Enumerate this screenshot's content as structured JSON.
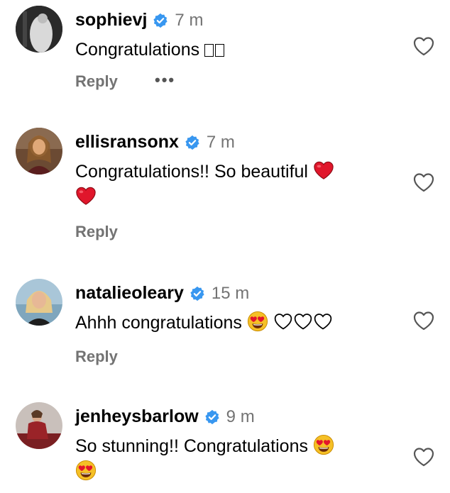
{
  "comments": [
    {
      "username": "sophievj",
      "time": "7 m",
      "text": "Congratulations",
      "text_suffix_glyphs": "□□",
      "reply_label": "Reply",
      "more_label": "•••",
      "verified": true
    },
    {
      "username": "ellisransonx",
      "time": "7 m",
      "text": "Congratulations!! So beautiful",
      "emojis": [
        "red-heart",
        "red-heart"
      ],
      "reply_label": "Reply",
      "verified": true
    },
    {
      "username": "natalieoleary",
      "time": "15 m",
      "text": "Ahhh congratulations",
      "emojis": [
        "heart-eyes",
        "white-heart",
        "white-heart",
        "white-heart"
      ],
      "reply_label": "Reply",
      "verified": true
    },
    {
      "username": "jenheysbarlow",
      "time": "9 m",
      "text": "So stunning!! Congratulations",
      "emojis": [
        "heart-eyes",
        "heart-eyes"
      ],
      "verified": true
    }
  ],
  "colors": {
    "verified_blue": "#3897f0",
    "meta_gray": "#737373",
    "heart_red": "#e0162b"
  },
  "icons": [
    "verified-badge-icon",
    "like-heart-icon",
    "more-options-icon"
  ]
}
